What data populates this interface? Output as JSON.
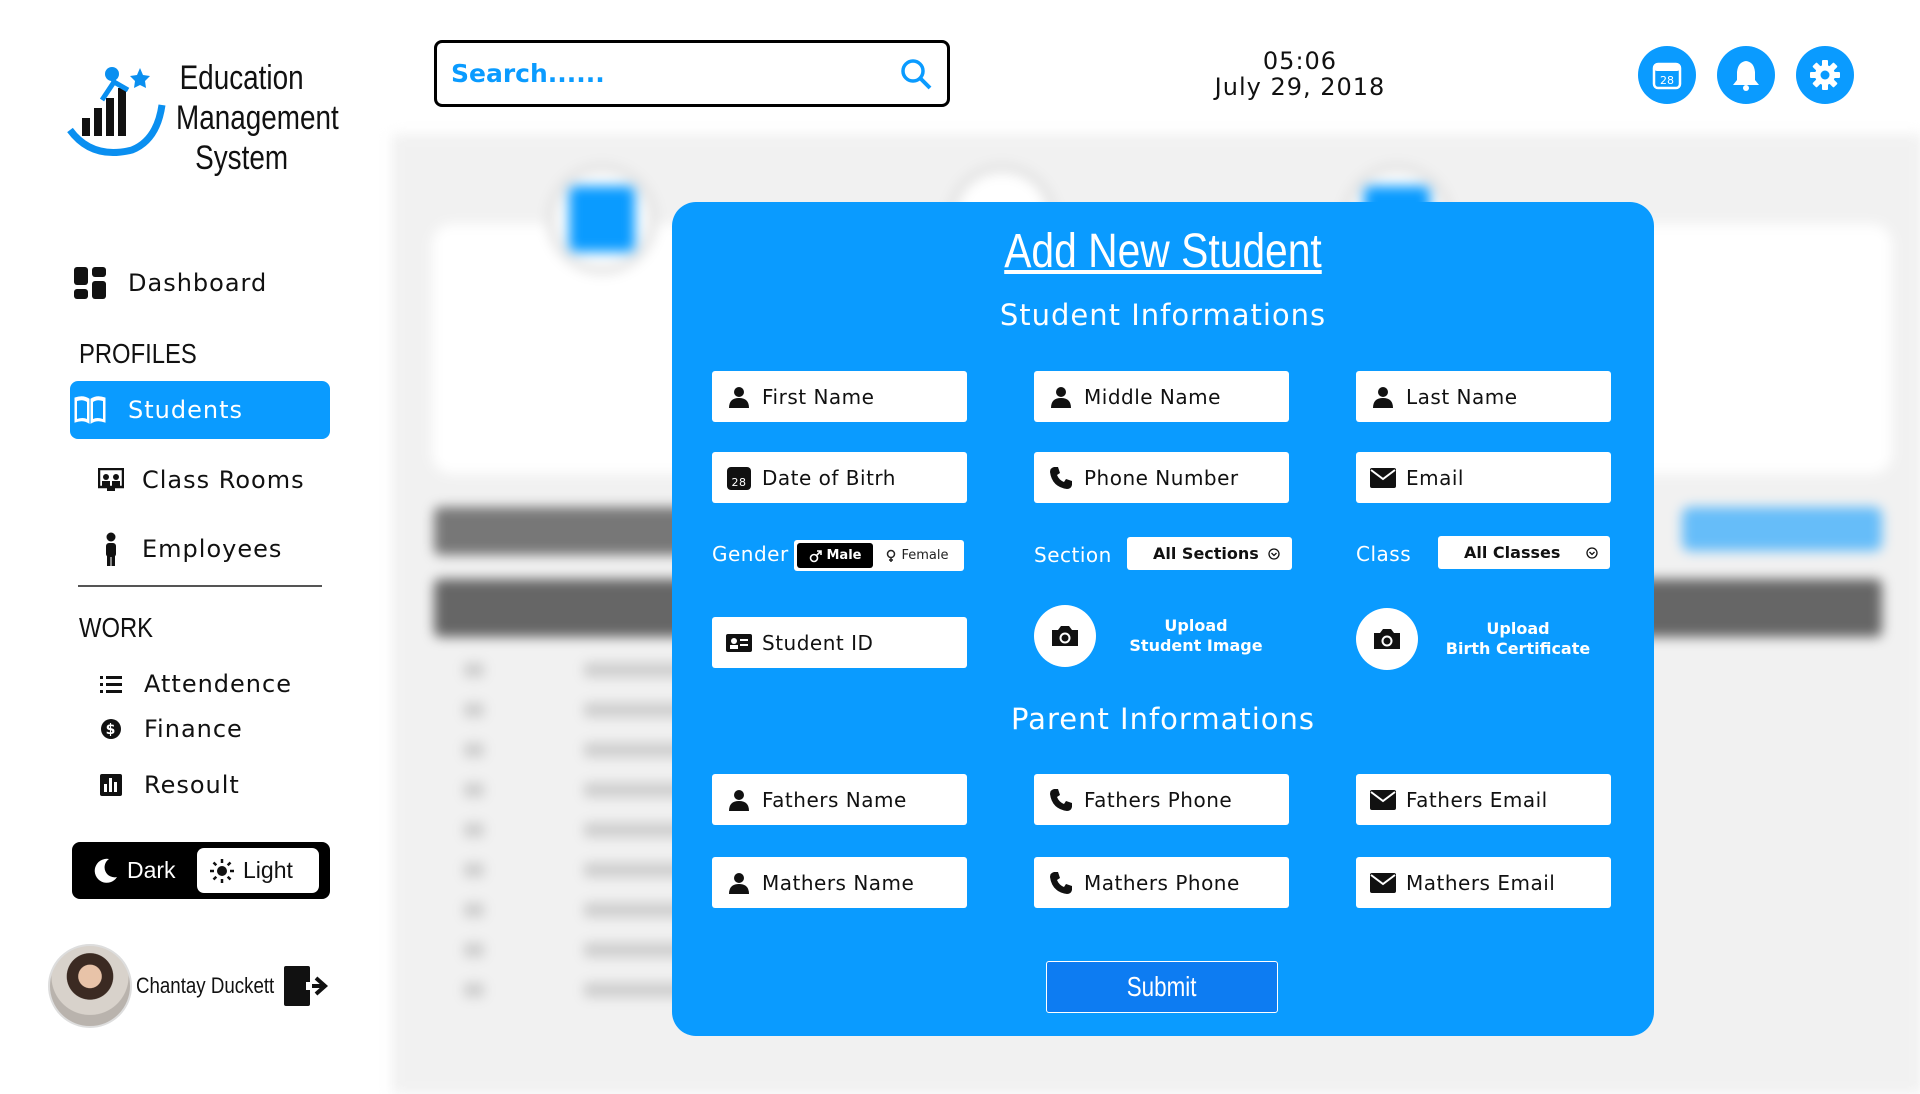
{
  "brand": {
    "line1": "Education",
    "line2": "Management",
    "line3": "System"
  },
  "nav": {
    "dashboard": "Dashboard",
    "profiles_title": "PROFILES",
    "students": "Students",
    "classrooms": "Class Rooms",
    "employees": "Employees",
    "work_title": "WORK",
    "attendance": "Attendence",
    "finance": "Finance",
    "result": "Resoult"
  },
  "theme": {
    "dark": "Dark",
    "light": "Light",
    "selected": "Light"
  },
  "user": {
    "name": "Chantay Duckett"
  },
  "search": {
    "placeholder": "Search......"
  },
  "clock": {
    "time": "05:06",
    "date": "July 29, 2018"
  },
  "top_icons": [
    "calendar-icon",
    "bell-icon",
    "gear-icon"
  ],
  "calendar_day": "28",
  "modal": {
    "title": "Add New Student",
    "student_section": "Student Informations",
    "parent_section": "Parent Informations",
    "fields": {
      "first_name": "First Name",
      "middle_name": "Middle Name",
      "last_name": "Last Name",
      "dob": "Date of Bitrh",
      "phone": "Phone Number",
      "email": "Email",
      "student_id": "Student ID",
      "fathers_name": "Fathers Name",
      "fathers_phone": "Fathers Phone",
      "fathers_email": "Fathers Email",
      "mothers_name": "Mathers Name",
      "mothers_phone": "Mathers Phone",
      "mothers_email": "Mathers Email"
    },
    "gender": {
      "label": "Gender",
      "male": "Male",
      "female": "Female",
      "selected": "Male"
    },
    "section": {
      "label": "Section",
      "value": "All Sections"
    },
    "class": {
      "label": "Class",
      "value": "All Classes"
    },
    "upload_student": {
      "line1": "Upload",
      "line2": "Student Image"
    },
    "upload_birth": {
      "line1": "Upload",
      "line2": "Birth Certificate"
    },
    "submit": "Submit"
  },
  "colors": {
    "accent": "#0a9bff",
    "submit": "#0d7cf2",
    "dark": "#000000"
  }
}
